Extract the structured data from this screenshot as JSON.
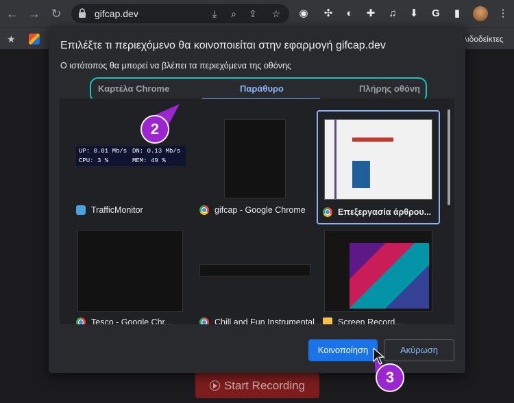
{
  "browser": {
    "url": "gifcap.dev",
    "bookmarks_text": "λιδοδείκτες"
  },
  "icons": [
    "back-icon",
    "forward-icon",
    "reload-icon",
    "lock-icon",
    "install-icon",
    "zoom-icon",
    "share-icon",
    "bookmark-star-icon",
    "extension-icons",
    "puzzle-icon",
    "media-icon",
    "download-icon",
    "google-icon",
    "sidepanel-icon",
    "avatar",
    "menu-icon"
  ],
  "dialog": {
    "title": "Επιλέξτε τι περιεχόμενο θα κοινοποιείται στην εφαρμογή gifcap.dev",
    "subtitle": "Ο ιστότοπος θα μπορεί να βλέπει τα περιεχόμενα της οθόνης",
    "tabs": [
      {
        "label": "Καρτέλα Chrome",
        "active": false
      },
      {
        "label": "Παράθυρο",
        "active": true
      },
      {
        "label": "Πλήρης οθόνη",
        "active": false
      }
    ],
    "windows": [
      {
        "label": "TrafficMonitor",
        "icon": "trafficmonitor-icon",
        "selected": false
      },
      {
        "label": "gifcap - Google Chrome",
        "icon": "chrome-icon",
        "selected": false
      },
      {
        "label": "Επεξεργασία άρθρου...",
        "icon": "chrome-icon",
        "selected": true
      },
      {
        "label": "Tesco - Google Chr...",
        "icon": "chrome-icon",
        "selected": false
      },
      {
        "label": "Chill and Fun Instrumental...",
        "icon": "chrome-icon",
        "selected": false
      },
      {
        "label": "Screen Record...",
        "icon": "folder-icon",
        "selected": false
      }
    ],
    "trafficmonitor": {
      "up": "UP: 0.01 Mb/s",
      "dn": "DN: 0.13 Mb/s",
      "cpu": "CPU: 3 %",
      "mem": "MEM: 49 %"
    },
    "share_label": "Κοινοποίηση",
    "cancel_label": "Ακύρωση"
  },
  "page": {
    "start_label": "Start Recording"
  },
  "annotations": {
    "callout_2": "2",
    "callout_3": "3"
  },
  "colors": {
    "accent": "#8ab4f8",
    "share_button": "#1a73e8",
    "highlight_ring": "#18c4c4",
    "callout": "#9b26cf",
    "start_button": "#7c1c1c"
  }
}
